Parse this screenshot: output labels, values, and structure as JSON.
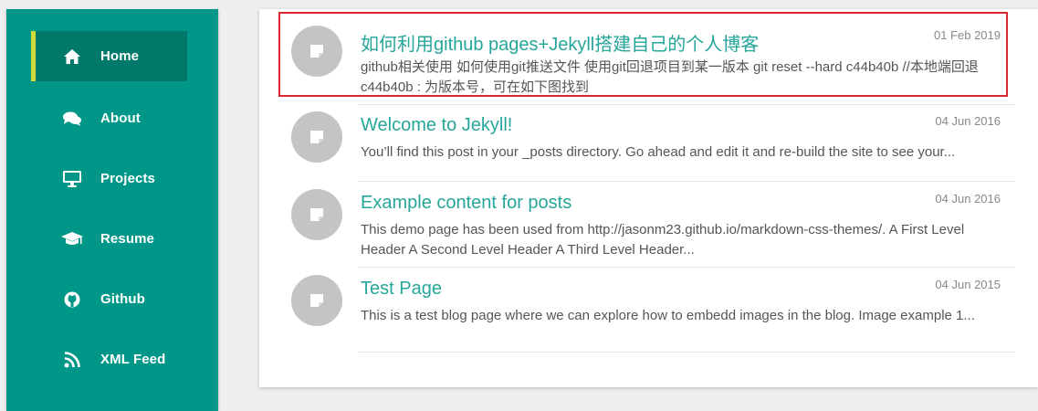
{
  "sidebar": {
    "items": [
      {
        "label": "Home",
        "icon": "home-icon",
        "active": true
      },
      {
        "label": "About",
        "icon": "comments-icon",
        "active": false
      },
      {
        "label": "Projects",
        "icon": "monitor-icon",
        "active": false
      },
      {
        "label": "Resume",
        "icon": "graduation-cap-icon",
        "active": false
      },
      {
        "label": "Github",
        "icon": "github-icon",
        "active": false
      },
      {
        "label": "XML Feed",
        "icon": "rss-icon",
        "active": false
      }
    ]
  },
  "posts": [
    {
      "title": "如何利用github pages+Jekyll搭建自己的个人博客",
      "date": "01 Feb 2019",
      "excerpt": "github相关使用 如何使用git推送文件 使用git回退项目到某一版本 git reset --hard c44b40b //本地端回退 c44b40b : 为版本号，可在如下图找到",
      "highlighted": true
    },
    {
      "title": "Welcome to Jekyll!",
      "date": "04 Jun 2016",
      "excerpt": "You’ll find this post in your _posts directory. Go ahead and edit it and re-build the site to see your...",
      "highlighted": false
    },
    {
      "title": "Example content for posts",
      "date": "04 Jun 2016",
      "excerpt": "This demo page has been used from http://jasonm23.github.io/markdown-css-themes/. A First Level Header A Second Level Header A Third Level Header...",
      "highlighted": false
    },
    {
      "title": "Test Page",
      "date": "04 Jun 2015",
      "excerpt": "This is a test blog page where we can explore how to embedd images in the blog. Image example 1...",
      "highlighted": false
    }
  ],
  "colors": {
    "sidebar_bg": "#009688",
    "active_item_bg": "#00796b",
    "active_indicator": "#cddc39",
    "title_color": "#26a69a",
    "highlight_border": "#d9272e"
  }
}
